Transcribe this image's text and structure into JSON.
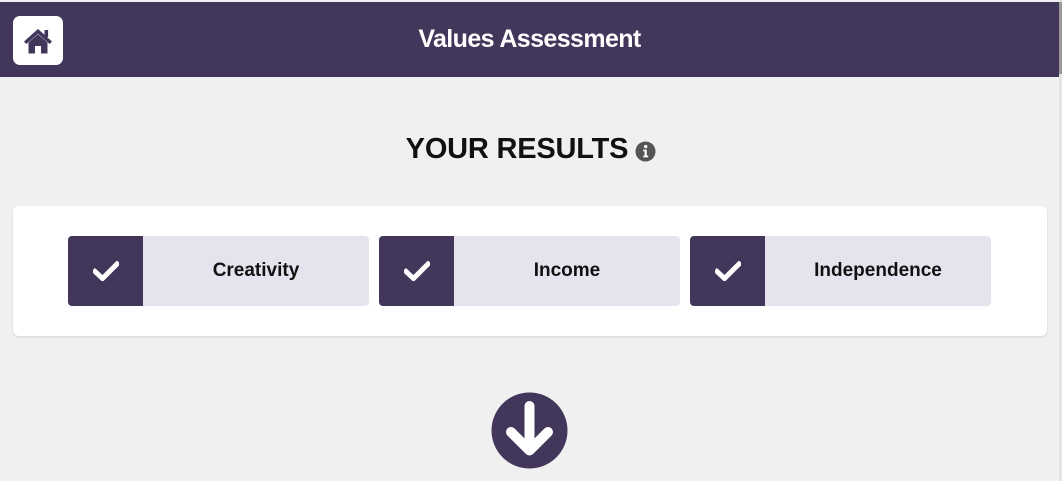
{
  "header": {
    "title": "Values Assessment",
    "home_icon": "home-icon",
    "background_color": "#42365a"
  },
  "results": {
    "heading": "YOUR RESULTS",
    "info_icon": "info-icon",
    "values": [
      {
        "label": "Creativity",
        "icon": "check-icon"
      },
      {
        "label": "Income",
        "icon": "check-icon"
      },
      {
        "label": "Independence",
        "icon": "check-icon"
      }
    ]
  },
  "navigation": {
    "scroll_down_icon": "arrow-down-circle-icon"
  },
  "colors": {
    "accent": "#42365a",
    "value_item_bg": "#e7e3ee",
    "page_bg": "#f0f0f0"
  }
}
